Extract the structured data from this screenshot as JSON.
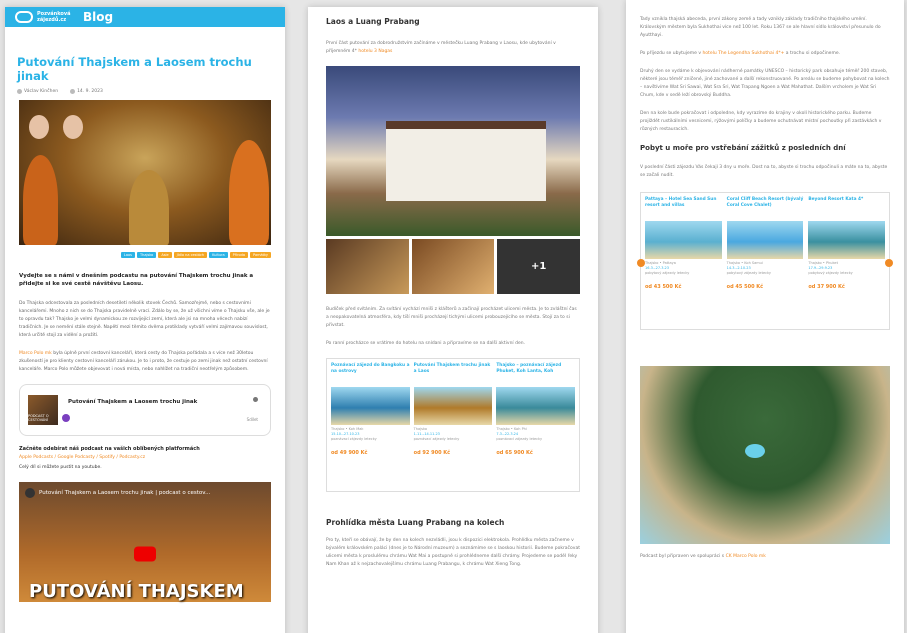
{
  "panel1": {
    "logo_text": "Pozvánková zájezdů.cz",
    "blog_title": "Blog",
    "post_title": "Putování Thajskem a Laosem trochu jinak",
    "author": "Václav Kinčhen",
    "date": "14. 9. 2023",
    "tags": [
      {
        "label": "Laos",
        "color": "#2bb3e6"
      },
      {
        "label": "Thajsko",
        "color": "#2bb3e6"
      },
      {
        "label": "Asie",
        "color": "#f5a623"
      },
      {
        "label": "Jídlo na cestách",
        "color": "#f5a623"
      },
      {
        "label": "Kultura",
        "color": "#2bb3e6"
      },
      {
        "label": "Příroda",
        "color": "#f5a623"
      },
      {
        "label": "Památky",
        "color": "#f5a623"
      }
    ],
    "lead": "Vydejte se s námi v dnešním podcastu na putování Thajskem trochu jinak a přidejte si ke své cestě návštěvu Laosu.",
    "para1": "Do Thajska odcestovala za posledních desetiletí několik stovek Čechů. Samozřejmě, nebo s cestovními kancelářemi. Mnoho z nich se do Thajska pravidelně vrací. Zdálo by se, že už všichni víme o Thajsku vše, ale je to opravdu tak? Thajsko je velmi dynamickou ze rozvíjející zemí, která ale jsi na mnoha věcech nabízí tradičních. Je se nemění stále stejně. Napětí mezi těmito dvěma protiklady vytváří velmi zajímavou souvislost, která určitě stojí za vidění a prožití.",
    "para2_link": "Marco Polo mk",
    "para2": " byla úplně první cestovní kanceláří, která cesty do Thajska pořádala a s více než 30letou zkušeností je pro klienty cestovní kanceláří zárukou. Je to i proto, že cestuje po zemi jinak než ostatní cestovní kanceláře. Marco Polo můžete objevovat i nová místa, nebo nahlížet na tradiční neotřelým způsobem.",
    "podcast_thumb": "PODCAST O CESTOVÁNÍ",
    "podcast_title": "Putování Thajskem a Laosem trochu jinak",
    "podcast_share": "Sdílet",
    "start_title": "Začněte odebírat náš podcast na vašich oblíbených platformách",
    "platforms": "Apple Podcasts / Google Podcasty / Spotify / Podcasty.cz",
    "youtube_note": "Celý díl si můžete pustit na youtube.",
    "video_title": "Putování Thajskem a Laosem trochu jinak | podcast o cestov...",
    "video_big": "PUTOVÁNÍ THAJSKEM"
  },
  "panel2": {
    "heading1": "Laos a Luang Prabang",
    "text1": "První část putování za dobrodružstvím začínáme v městečku Luang Prabang v Laosu, kde ubytování v příjemném 4*",
    "text1_link": "hotelu 3 Nagas",
    "thumb_more": "+1",
    "text2": "Budíček před svítáním. Za svítání vychází mniši z klášterů a začínají procházet ulicemi města. Je to zvláštní čas a neopakovatelná atmosféra, kdy tiší mniši procházejí tichými ulicemi probouzejícího se města. Stojí za to si přivstat.",
    "text3": "Po ranní procházce se vrátíme do hotelu na snídani a připravíme se na další aktivní den.",
    "cards": [
      {
        "title": "Poznávací zájezd do Bangkoku a na ostrovy",
        "meta": "Thajsko • Koh Mak",
        "date": "15.10.–27.10.23",
        "tags": "poznávací zájezdy   letecky",
        "price": "od 49 900 Kč",
        "color": "#2f7fb0"
      },
      {
        "title": "Putování Thajskem trochu jinak a Laos",
        "meta": "Thajsko",
        "date": "1.11.–14.11.23",
        "tags": "poznávací zájezdy   letecky",
        "price": "od 92 900 Kč",
        "color": "#b07a2a"
      },
      {
        "title": "Thajsko – poznávací zájezd Phuket, Koh Lanta, Koh",
        "meta": "Thajsko • Koh Phi",
        "date": "7.3.–22.3.24",
        "tags": "poznávací zájezdy   letecky",
        "price": "od 65 900 Kč",
        "color": "#3a8a9a"
      }
    ],
    "heading2": "Prohlídka města Luang Prabang na kolech",
    "text4": "Pro ty, kteří se obávají, že by den na kolech nezvládli, jsou k dispozici elektrokola. Prohlídku města začneme v bývalém královském paláci (dnes je to Národní muzeum) a seznámíme se s laoskou historií. Budeme pokračovat ulicemi města k proslulému chrámu Wat Mai a postupně si prohlédneme další chrámy. Projedeme se podél řeky Nam Khan až k nejzachovalejšímu chrámu Luang Prabangu, k chrámu Wat Xieng Tong."
  },
  "panel3": {
    "text1": "Tady vznikla thajská abeceda, první zákony země a tady vznikly základy tradičního thajského umění. Královským městem byla Sukhothai více než 100 let. Roku 1367 se ale hlavní sídlo království přesunulo do Ayutthayi.",
    "text2_pre": "Po příjezdu se ubytujeme v ",
    "text2_link": "hotelu The Legendha Sukhothai 4*+",
    "text2_post": " a trochu si odpočineme.",
    "text3": "Druhý den se vydáme k objevování nádherné památky UNESCO – historický park obsahuje téměř 200 staveb, některé jsou téměř zničené, jiné zachované a další rekonstruované. Po areálu se budeme pohybovat na kolech – navštívíme Wat Sri Sawai, Wat Sra Sri, Wat Trapang Ngoen a Wat Mahathat. Dalším vrcholem je Wat Sri Chum, kde v sedě leží obrovský Buddha.",
    "text4": "Den na kole bude pokračovat i odpoledne, kdy vyrazíme do krajiny v okolí historického parku. Budeme projíždět rustikálními vesnicemi, rýžovými políčky a budeme ochutnávat místní pochoutky při zastávkách v různých restauracích.",
    "heading": "Pobyt u moře pro vstřebání zážitků z posledních dní",
    "text5": "V poslední části zájezdu Vás čekají 3 dny u moře. Dost na to, abyste si trochu odpočinuli a máte na to, abyste se začali nudit.",
    "offers": [
      {
        "title": "Pattaya – Hotel Sea Sand Sun resort and villas",
        "meta": "Thajsko • Pattaya",
        "date": "16.3.–27.3.23",
        "tags": "pobytový zájezdy   letecky",
        "price": "od 43 500 Kč",
        "color": "#5ab0d0"
      },
      {
        "title": "Coral Cliff Beach Resort (bývalý Coral Cove Chalet)",
        "meta": "Thajsko • Koh Samui",
        "date": "14.3.–2.10.23",
        "tags": "pobytový zájezdy   letecky",
        "price": "od 45 500 Kč",
        "color": "#4aa8e0"
      },
      {
        "title": "Beyond Resort Kata 4*",
        "meta": "Thajsko • Phuket",
        "date": "17.9.–29.9.23",
        "tags": "pobytový zájezdy   letecky",
        "price": "od 37 900 Kč",
        "color": "#3a90a0"
      }
    ],
    "credit_pre": "Podcast byl připraven ve spolupráci s ",
    "credit_link": "CK Marco Polo mk"
  }
}
